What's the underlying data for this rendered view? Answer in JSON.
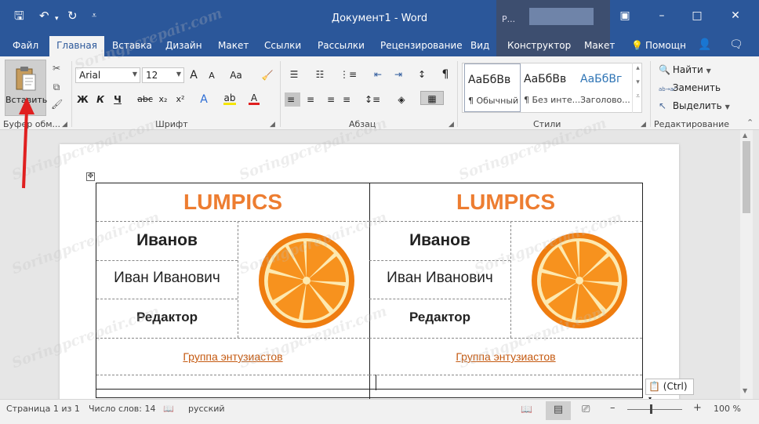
{
  "window": {
    "title": "Документ1 - Word",
    "context_label": "Р...",
    "minimize_glyph": "–",
    "restore_glyph": "□",
    "close_glyph": "✕",
    "ribbon_toggle_glyph": "▣"
  },
  "qat": {
    "save_glyph": "🖫",
    "undo_glyph": "↶",
    "undo_more": "▾",
    "redo_glyph": "↻",
    "customize_glyph": "⩡"
  },
  "tabs": {
    "file": "Файл",
    "home": "Главная",
    "insert": "Вставка",
    "design": "Дизайн",
    "layout": "Макет",
    "references": "Ссылки",
    "mailings": "Рассылки",
    "review": "Рецензирование",
    "view": "Вид",
    "constructor": "Конструктор",
    "layout2": "Макет",
    "help": "Помощн",
    "help_icon": "💡",
    "share_icon": "👤",
    "comment_icon": "🗨"
  },
  "clipboard": {
    "paste_label": "Вставить",
    "group_label": "Буфер обм...",
    "cut_glyph": "✂",
    "copy_glyph": "⧉",
    "painter_glyph": "🖌"
  },
  "font": {
    "family": "Arial",
    "size": "12",
    "grow": "A",
    "grow_sup": "^",
    "shrink": "A",
    "case": "Aa",
    "clear": "🧹",
    "bold": "Ж",
    "italic": "К",
    "underline": "Ч",
    "strike": "abc",
    "sub": "x₂",
    "sup": "x²",
    "effects": "A",
    "highlight": "ab",
    "color": "A",
    "group_label": "Шрифт"
  },
  "paragraph": {
    "group_label": "Абзац",
    "pilcrow": "¶",
    "bullets": "☰",
    "numbering": "☷",
    "multilevel": "⋮≡",
    "decrease_indent": "⇤",
    "increase_indent": "⇥",
    "sort": "↕",
    "align_left": "≡",
    "center": "≡",
    "align_right": "≡",
    "justify": "≡",
    "spacing": "↕≡",
    "shading": "◈",
    "borders": "▦"
  },
  "styles": {
    "group_label": "Стили",
    "items": [
      {
        "sample": "АаБбВв",
        "name": "¶ Обычный"
      },
      {
        "sample": "АаБбВв",
        "name": "¶ Без инте..."
      },
      {
        "sample": "АаБбВг",
        "name": "Заголово..."
      }
    ],
    "up_glyph": "▴",
    "down_glyph": "▾",
    "more_glyph": "⩡"
  },
  "editing": {
    "group_label": "Редактирование",
    "find": "Найти",
    "find_glyph": "🔍",
    "replace": "Заменить",
    "replace_glyph": "ab→ac",
    "select": "Выделить",
    "select_glyph": "↖",
    "collapse_glyph": "⌃"
  },
  "document": {
    "move_handle": "✥",
    "cards": [
      {
        "logo": "LUMPICS",
        "surname": "Иванов",
        "given": "Иван Иванович",
        "role": "Редактор",
        "group": "Группа энтузиастов"
      },
      {
        "logo": "LUMPICS",
        "surname": "Иванов",
        "given": "Иван Иванович",
        "role": "Редактор",
        "group": "Группа энтузиастов"
      }
    ],
    "paste_options": "(Ctrl)",
    "paste_options_arrow": "▾"
  },
  "status": {
    "page": "Страница 1 из 1",
    "words": "Число слов: 14",
    "proof_glyph": "📖",
    "language": "русский",
    "read_mode_glyph": "📖",
    "print_layout_glyph": "▤",
    "web_layout_glyph": "⎚",
    "zoom_out": "–",
    "zoom_in": "+",
    "zoom": "100 %"
  },
  "scroll": {
    "up": "▲",
    "down": "▼"
  },
  "watermark_text": "Soringpcrepair.com",
  "colors": {
    "title_bar": "#2b579a",
    "context_tab": "#3d4e6f",
    "logo_orange": "#ed7d31",
    "link_brown": "#c55a11",
    "arrow_red": "#e02020"
  }
}
